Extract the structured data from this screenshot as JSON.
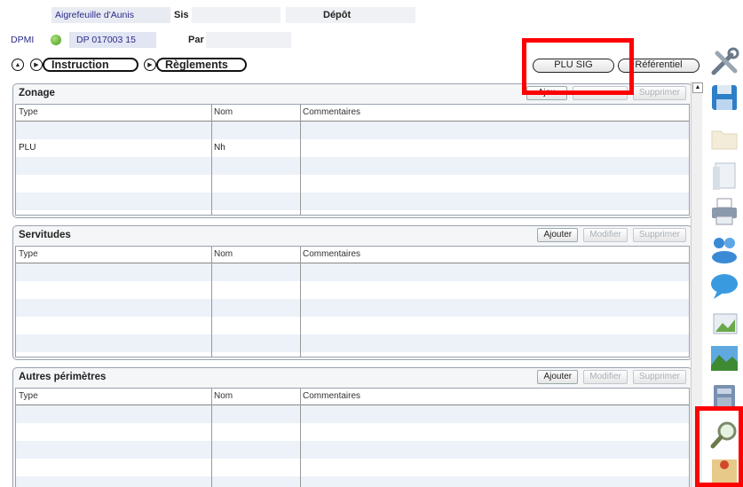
{
  "header": {
    "commune": "Aigrefeuille d'Aunis",
    "sis_label": "Sis",
    "depot_label": "Dépôt",
    "dossier_type": "DPMI",
    "dossier_number": "DP 017003 15",
    "par_label": "Par"
  },
  "nav": {
    "instruction": "Instruction",
    "reglements": "Règlements",
    "plu_sig": "PLU SIG",
    "referentiel": "Référentiel"
  },
  "buttons": {
    "add": "Ajouter",
    "modify": "Modifier",
    "delete": "Supprimer"
  },
  "columns": {
    "type": "Type",
    "nom": "Nom",
    "commentaires": "Commentaires"
  },
  "zonage": {
    "title": "Zonage",
    "add_label": "Ajou",
    "rows": [
      {
        "type": "",
        "nom": "",
        "comment": ""
      },
      {
        "type": "PLU",
        "nom": "Nh",
        "comment": ""
      }
    ]
  },
  "servitudes": {
    "title": "Servitudes"
  },
  "autres": {
    "title": "Autres périmètres"
  },
  "toolbar_icons": [
    "tools-icon",
    "save-icon",
    "folder-icon",
    "document-icon",
    "print-icon",
    "users-icon",
    "chat-bubble-icon",
    "image-icon",
    "landscape-icon",
    "calculator-icon",
    "search-icon",
    "map-icon"
  ],
  "colors": {
    "highlight": "#ff0000",
    "status_green": "#4a9a1e",
    "row_alt": "#edf1f8"
  }
}
